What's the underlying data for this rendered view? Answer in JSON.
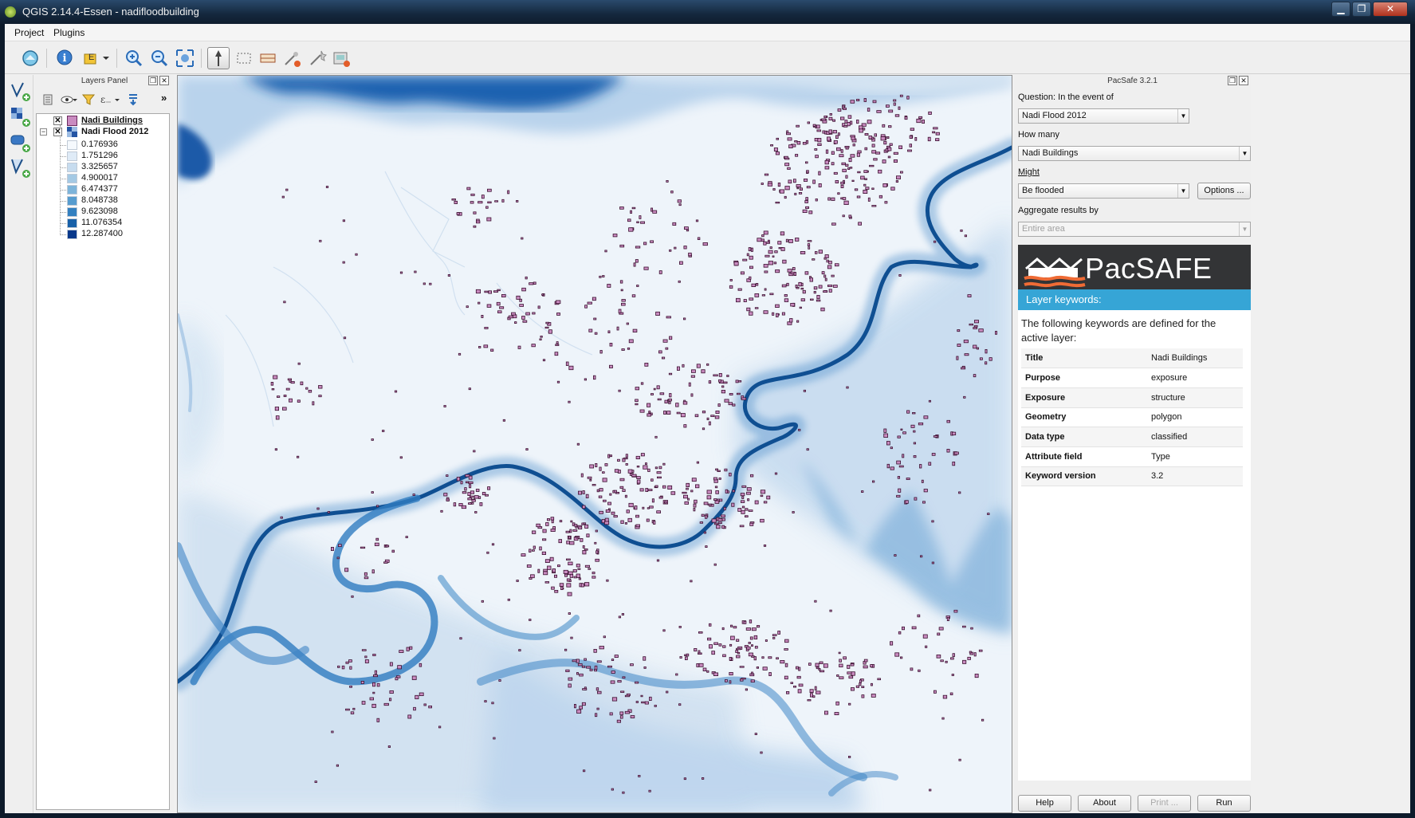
{
  "window": {
    "title": "QGIS 2.14.4-Essen - nadifloodbuilding"
  },
  "menu": {
    "items": [
      "Project",
      "Plugins"
    ]
  },
  "layers_panel": {
    "title": "Layers Panel",
    "layers": [
      {
        "name": "Nadi Buildings",
        "checked": "✕",
        "swatch_color": "#c98bc0"
      },
      {
        "name": "Nadi Flood 2012",
        "checked": "✕"
      }
    ],
    "legend": [
      {
        "value": "0.176936",
        "color": "#f5f9fd"
      },
      {
        "value": "1.751296",
        "color": "#dfebf7"
      },
      {
        "value": "3.325657",
        "color": "#c7dcef"
      },
      {
        "value": "4.900017",
        "color": "#a4c9e4"
      },
      {
        "value": "6.474377",
        "color": "#7db4da"
      },
      {
        "value": "8.048738",
        "color": "#569ccf"
      },
      {
        "value": "9.623098",
        "color": "#3380c0"
      },
      {
        "value": "11.076354",
        "color": "#1760a8"
      },
      {
        "value": "12.287400",
        "color": "#08388a"
      }
    ]
  },
  "pacsafe": {
    "title": "PacSafe 3.2.1",
    "question_label": "Question: In the event of",
    "hazard": "Nadi Flood 2012",
    "how_many_label": "How many",
    "exposure": "Nadi Buildings",
    "might_label": "Might",
    "function": "Be flooded",
    "options_button": "Options ...",
    "aggregate_label": "Aggregate results by",
    "aggregate_value": "Entire area",
    "logo_text": "PacSAFE",
    "keywords_header": "Layer keywords:",
    "keywords_intro": "The following keywords are defined for the active layer:",
    "keywords": [
      {
        "key": "Title",
        "value": "Nadi Buildings"
      },
      {
        "key": "Purpose",
        "value": "exposure"
      },
      {
        "key": "Exposure",
        "value": "structure"
      },
      {
        "key": "Geometry",
        "value": "polygon"
      },
      {
        "key": "Data type",
        "value": "classified"
      },
      {
        "key": "Attribute field",
        "value": "Type"
      },
      {
        "key": "Keyword version",
        "value": "3.2"
      }
    ],
    "buttons": {
      "help": "Help",
      "about": "About",
      "print": "Print ...",
      "run": "Run"
    }
  },
  "colors": {
    "accent": "#36a5d6",
    "river": "#0f4f92",
    "building": "#c98bc0"
  }
}
